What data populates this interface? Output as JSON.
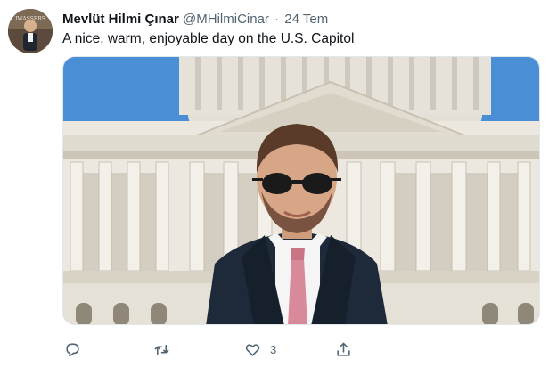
{
  "author": {
    "display_name": "Mevlüt Hilmi Çınar",
    "handle": "@MHilmiCinar",
    "separator": "·",
    "date": "24 Tem"
  },
  "tweet": {
    "text": "A nice, warm, enjoyable day on the U.S. Capitol"
  },
  "actions": {
    "reply_icon": "speech-bubble-icon",
    "retweet_icon": "retweet-arrows-icon",
    "like_icon": "heart-icon",
    "like_count": "3",
    "share_icon": "share-upload-icon"
  },
  "colors": {
    "text": "#0f1419",
    "secondary": "#536471",
    "sky": "#4a8ed6",
    "capitol_stone": "#e9e5dd"
  }
}
